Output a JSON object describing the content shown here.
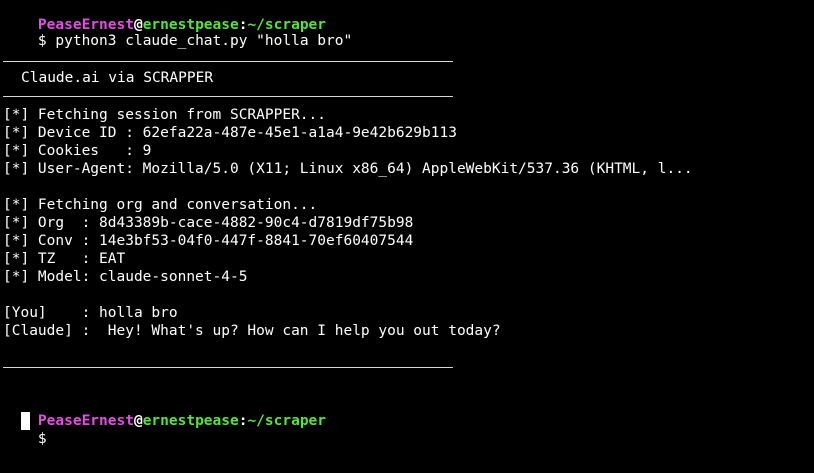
{
  "prompt": {
    "user": "PeaseErnest",
    "at": "@",
    "host": "ernestpease",
    "colon": ":",
    "path": "~/scraper",
    "dollar": "$"
  },
  "command": "python3 claude_chat.py \"holla bro\"",
  "banner_title": "Claude.ai via SCRAPPER",
  "log": [
    "[*] Fetching session from SCRAPPER...",
    "[*] Device ID : 62efa22a-487e-45e1-a1a4-9e42b629b113",
    "[*] Cookies   : 9",
    "[*] User-Agent: Mozilla/5.0 (X11; Linux x86_64) AppleWebKit/537.36 (KHTML, l...",
    "[*] Fetching org and conversation...",
    "[*] Org  : 8d43389b-cace-4882-90c4-d7819df75b98",
    "[*] Conv : 14e3bf53-04f0-447f-8841-70ef60407544",
    "[*] TZ   : EAT",
    "[*] Model: claude-sonnet-4-5"
  ],
  "conversation": {
    "you": "[You]    : holla bro",
    "claude": "[Claude] :  Hey! What's up? How can I help you out today?"
  },
  "colors": {
    "background": "#000000",
    "user": "#e04fe0",
    "host_path": "#55e43a",
    "text": "#ffffff"
  }
}
